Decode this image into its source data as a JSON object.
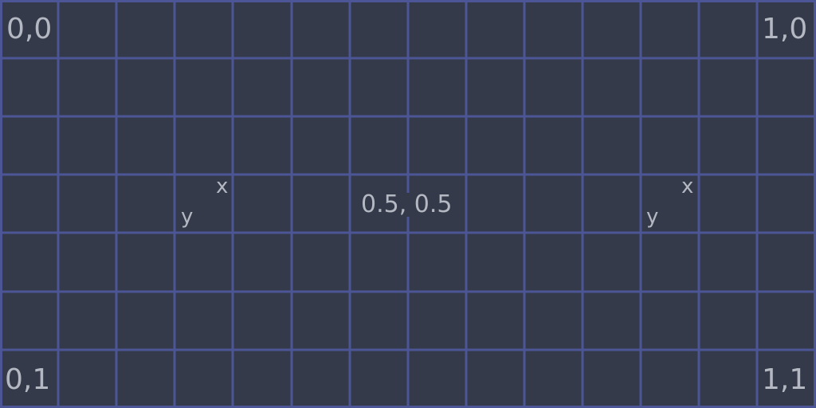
{
  "colors": {
    "background": "#353a4b",
    "grid_line": "#4c5595",
    "label": "#b4b8c2"
  },
  "labels": {
    "top_left": "0,0",
    "top_right": "1,0",
    "bottom_left": "0,1",
    "bottom_right": "1,1",
    "center": "0.5, 0.5",
    "left_marker": {
      "x": "x",
      "y": "y"
    },
    "right_marker": {
      "x": "x",
      "y": "y"
    }
  }
}
